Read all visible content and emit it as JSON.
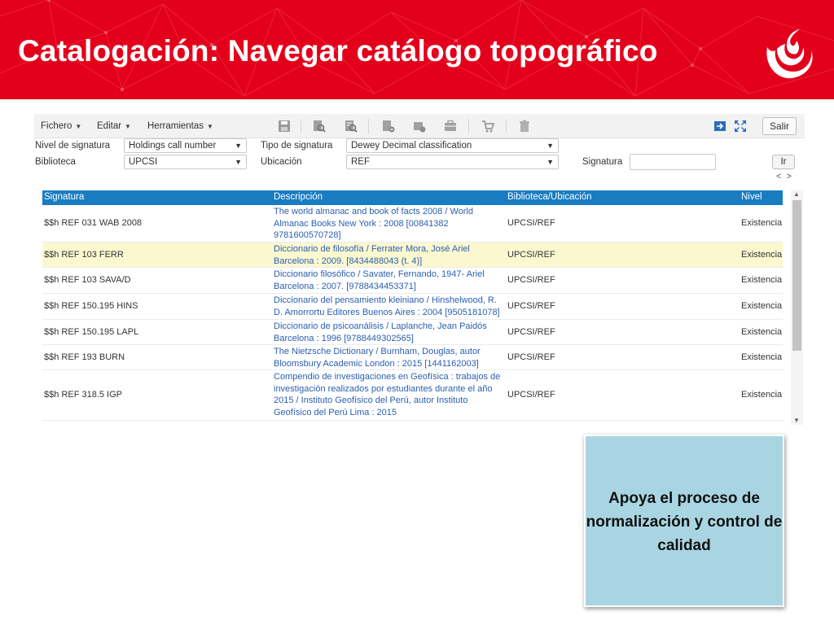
{
  "slide": {
    "title": "Catalogación: Navegar catálogo topográfico",
    "brand_color": "#e3001b",
    "logo": "upc-flame-logo"
  },
  "toolbar": {
    "menus": [
      "Fichero",
      "Editar",
      "Herramientas"
    ],
    "icons": [
      "save-icon",
      "search-record-icon",
      "search-list-icon",
      "edit-record-icon",
      "move-record-icon",
      "briefcase-icon",
      "cart-icon",
      "trash-icon",
      "export-icon",
      "expand-icon"
    ],
    "exit_label": "Salir"
  },
  "form": {
    "nivel_label": "Nivel de signatura",
    "nivel_value": "Holdings call number",
    "tipo_label": "Tipo de signatura",
    "tipo_value": "Dewey Decimal classification",
    "biblioteca_label": "Biblioteca",
    "biblioteca_value": "UPCSI",
    "ubicacion_label": "Ubicación",
    "ubicacion_value": "REF",
    "signatura_label": "Signatura",
    "signatura_value": "",
    "go_label": "Ir",
    "prev": "<",
    "next": ">"
  },
  "grid": {
    "headers": [
      "Signatura",
      "Descripción",
      "Biblioteca/Ubicación",
      "Nivel"
    ],
    "header_color": "#1a7cc1",
    "rows": [
      {
        "sig": "$$h REF 031 WAB 2008",
        "desc": "The world almanac and book of facts 2008 / World Almanac Books New York : 2008 [00841382 9781600570728]",
        "lib": "UPCSI/REF",
        "nivel": "Existencia"
      },
      {
        "sig": "$$h REF 103 FERR",
        "desc": "Diccionario de filosofía / Ferrater Mora, José Ariel Barcelona : 2009. [8434488043 (t. 4)]",
        "lib": "UPCSI/REF",
        "nivel": "Existencia"
      },
      {
        "sig": "$$h REF 103 SAVA/D",
        "desc": "Diccionario filosófico / Savater, Fernando, 1947- Ariel Barcelona : 2007. [9788434453371]",
        "lib": "UPCSI/REF",
        "nivel": "Existencia"
      },
      {
        "sig": "$$h REF 150.195 HINS",
        "desc": "Diccionario del pensamiento kleiniano / Hinshelwood, R. D. Amorrortu Editores Buenos Aires : 2004 [9505181078]",
        "lib": "UPCSI/REF",
        "nivel": "Existencia"
      },
      {
        "sig": "$$h REF 150.195 LAPL",
        "desc": "Diccionario de psicoanálisis / Laplanche, Jean Paidós Barcelona : 1996 [9788449302565]",
        "lib": "UPCSI/REF",
        "nivel": "Existencia"
      },
      {
        "sig": "$$h REF 193 BURN",
        "desc": "The Nietzsche Dictionary / Burnham, Douglas, autor Bloomsbury Academic London : 2015 [1441162003]",
        "lib": "UPCSI/REF",
        "nivel": "Existencia"
      },
      {
        "sig": "$$h REF 318.5 IGP",
        "desc": "Compendio de investigaciones en Geofísica : trabajos de investigación realizados por estudiantes durante el año 2015 / Instituto Geofísico del Perú, autor Instituto Geofísico del Perú Lima : 2015",
        "lib": "UPCSI/REF",
        "nivel": "Existencia"
      }
    ]
  },
  "callout": {
    "text": "Apoya el proceso de normalización y control de calidad",
    "color": "#a9d5e2"
  }
}
